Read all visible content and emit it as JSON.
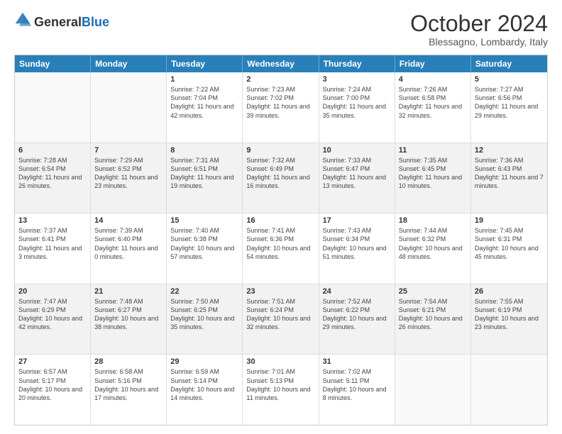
{
  "header": {
    "logo_general": "General",
    "logo_blue": "Blue",
    "title": "October 2024",
    "location": "Blessagno, Lombardy, Italy"
  },
  "calendar": {
    "days": [
      "Sunday",
      "Monday",
      "Tuesday",
      "Wednesday",
      "Thursday",
      "Friday",
      "Saturday"
    ],
    "weeks": [
      [
        {
          "day": "",
          "content": "",
          "empty": true
        },
        {
          "day": "",
          "content": "",
          "empty": true
        },
        {
          "day": "1",
          "content": "Sunrise: 7:22 AM\nSunset: 7:04 PM\nDaylight: 11 hours and 42 minutes."
        },
        {
          "day": "2",
          "content": "Sunrise: 7:23 AM\nSunset: 7:02 PM\nDaylight: 11 hours and 39 minutes."
        },
        {
          "day": "3",
          "content": "Sunrise: 7:24 AM\nSunset: 7:00 PM\nDaylight: 11 hours and 35 minutes."
        },
        {
          "day": "4",
          "content": "Sunrise: 7:26 AM\nSunset: 6:58 PM\nDaylight: 11 hours and 32 minutes."
        },
        {
          "day": "5",
          "content": "Sunrise: 7:27 AM\nSunset: 6:56 PM\nDaylight: 11 hours and 29 minutes."
        }
      ],
      [
        {
          "day": "6",
          "content": "Sunrise: 7:28 AM\nSunset: 6:54 PM\nDaylight: 11 hours and 26 minutes.",
          "shaded": true
        },
        {
          "day": "7",
          "content": "Sunrise: 7:29 AM\nSunset: 6:52 PM\nDaylight: 11 hours and 23 minutes.",
          "shaded": true
        },
        {
          "day": "8",
          "content": "Sunrise: 7:31 AM\nSunset: 6:51 PM\nDaylight: 11 hours and 19 minutes.",
          "shaded": true
        },
        {
          "day": "9",
          "content": "Sunrise: 7:32 AM\nSunset: 6:49 PM\nDaylight: 11 hours and 16 minutes.",
          "shaded": true
        },
        {
          "day": "10",
          "content": "Sunrise: 7:33 AM\nSunset: 6:47 PM\nDaylight: 11 hours and 13 minutes.",
          "shaded": true
        },
        {
          "day": "11",
          "content": "Sunrise: 7:35 AM\nSunset: 6:45 PM\nDaylight: 11 hours and 10 minutes.",
          "shaded": true
        },
        {
          "day": "12",
          "content": "Sunrise: 7:36 AM\nSunset: 6:43 PM\nDaylight: 11 hours and 7 minutes.",
          "shaded": true
        }
      ],
      [
        {
          "day": "13",
          "content": "Sunrise: 7:37 AM\nSunset: 6:41 PM\nDaylight: 11 hours and 3 minutes."
        },
        {
          "day": "14",
          "content": "Sunrise: 7:39 AM\nSunset: 6:40 PM\nDaylight: 11 hours and 0 minutes."
        },
        {
          "day": "15",
          "content": "Sunrise: 7:40 AM\nSunset: 6:38 PM\nDaylight: 10 hours and 57 minutes."
        },
        {
          "day": "16",
          "content": "Sunrise: 7:41 AM\nSunset: 6:36 PM\nDaylight: 10 hours and 54 minutes."
        },
        {
          "day": "17",
          "content": "Sunrise: 7:43 AM\nSunset: 6:34 PM\nDaylight: 10 hours and 51 minutes."
        },
        {
          "day": "18",
          "content": "Sunrise: 7:44 AM\nSunset: 6:32 PM\nDaylight: 10 hours and 48 minutes."
        },
        {
          "day": "19",
          "content": "Sunrise: 7:45 AM\nSunset: 6:31 PM\nDaylight: 10 hours and 45 minutes."
        }
      ],
      [
        {
          "day": "20",
          "content": "Sunrise: 7:47 AM\nSunset: 6:29 PM\nDaylight: 10 hours and 42 minutes.",
          "shaded": true
        },
        {
          "day": "21",
          "content": "Sunrise: 7:48 AM\nSunset: 6:27 PM\nDaylight: 10 hours and 38 minutes.",
          "shaded": true
        },
        {
          "day": "22",
          "content": "Sunrise: 7:50 AM\nSunset: 6:25 PM\nDaylight: 10 hours and 35 minutes.",
          "shaded": true
        },
        {
          "day": "23",
          "content": "Sunrise: 7:51 AM\nSunset: 6:24 PM\nDaylight: 10 hours and 32 minutes.",
          "shaded": true
        },
        {
          "day": "24",
          "content": "Sunrise: 7:52 AM\nSunset: 6:22 PM\nDaylight: 10 hours and 29 minutes.",
          "shaded": true
        },
        {
          "day": "25",
          "content": "Sunrise: 7:54 AM\nSunset: 6:21 PM\nDaylight: 10 hours and 26 minutes.",
          "shaded": true
        },
        {
          "day": "26",
          "content": "Sunrise: 7:55 AM\nSunset: 6:19 PM\nDaylight: 10 hours and 23 minutes.",
          "shaded": true
        }
      ],
      [
        {
          "day": "27",
          "content": "Sunrise: 6:57 AM\nSunset: 5:17 PM\nDaylight: 10 hours and 20 minutes."
        },
        {
          "day": "28",
          "content": "Sunrise: 6:58 AM\nSunset: 5:16 PM\nDaylight: 10 hours and 17 minutes."
        },
        {
          "day": "29",
          "content": "Sunrise: 6:59 AM\nSunset: 5:14 PM\nDaylight: 10 hours and 14 minutes."
        },
        {
          "day": "30",
          "content": "Sunrise: 7:01 AM\nSunset: 5:13 PM\nDaylight: 10 hours and 11 minutes."
        },
        {
          "day": "31",
          "content": "Sunrise: 7:02 AM\nSunset: 5:11 PM\nDaylight: 10 hours and 8 minutes."
        },
        {
          "day": "",
          "content": "",
          "empty": true
        },
        {
          "day": "",
          "content": "",
          "empty": true
        }
      ]
    ]
  }
}
